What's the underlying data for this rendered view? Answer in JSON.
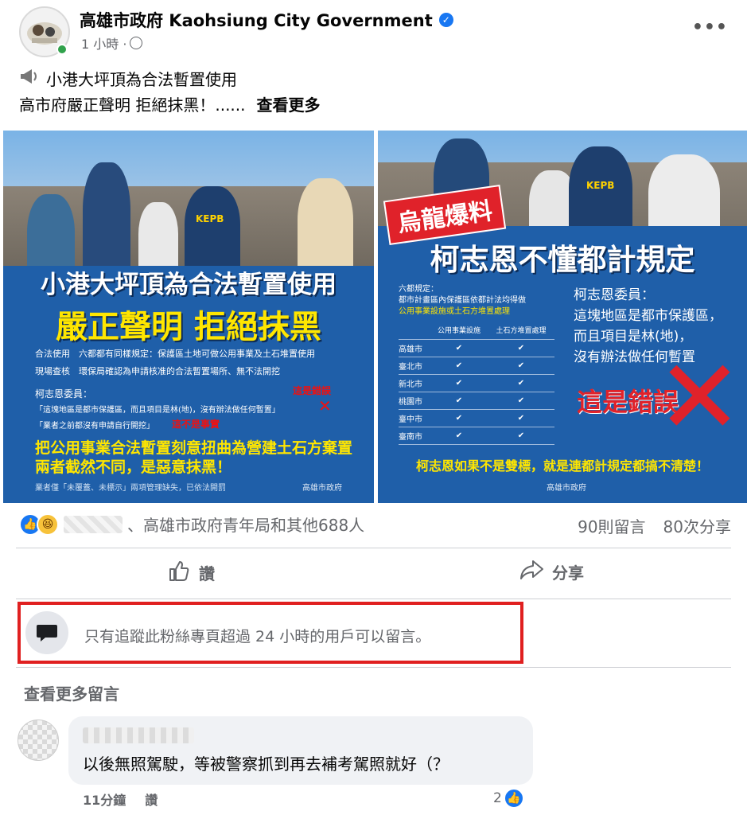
{
  "page": {
    "name": "高雄市政府 Kaohsiung City Government",
    "time": "1 小時 ·",
    "more_label": "•••"
  },
  "post": {
    "line1": "小港大坪頂為合法暫置使用",
    "line2": "高市府嚴正聲明 拒絕抹黑！......",
    "see_more": "查看更多"
  },
  "image_left": {
    "headline1": "小港大坪頂為合法暫置使用",
    "headline2": "嚴正聲明 拒絕抹黑",
    "kepb": "KEPB",
    "point1": "合法使用　六都都有同樣規定：保護區土地可做公用事業及土石堆置使用",
    "point2": "現場查核　環保局確認為申請核准的合法暫置場所、無不法開挖",
    "ko_label": "柯志恩委員：",
    "ko_quote1": "「這塊地區是都市保護區，而且項目是林(地)，沒有辦法做任何暫置」",
    "ko_quote2": "「業者之前都沒有申請自行開挖」",
    "wrong_tag1": "這是錯誤",
    "wrong_tag2": "這不是事實",
    "yellow1": "把公用事業合法暫置刻意扭曲為營建土石方棄置",
    "yellow2": "兩者截然不同，是惡意抹黑！",
    "footer": "業者僅「未覆蓋、未標示」兩項管理缺失，已依法開罰",
    "sign": "高雄市政府"
  },
  "image_right": {
    "banner": "烏龍爆料",
    "title": "柯志恩不懂都計規定",
    "rule_label": "六都規定：",
    "rule_text": "都市計畫區內保護區依都計法均得做",
    "rule_text2": "公用事業設施或土石方堆置處理",
    "col1": "公用事業設施",
    "col2": "土石方堆置處理",
    "cities": [
      "高雄市",
      "臺北市",
      "新北市",
      "桃園市",
      "臺中市",
      "臺南市"
    ],
    "check": "✔",
    "ko_label": "柯志恩委員：",
    "quote1": "這塊地區是都市保護區，",
    "quote2": "而且項目是林(地)，",
    "quote3": "沒有辦法做任何暫置",
    "wrong": "這是錯誤",
    "bottom": "柯志恩如果不是雙標，就是連都計規定都搞不清楚！",
    "sign": "高雄市政府"
  },
  "reactions": {
    "summary": "、高雄市政府青年局和其他688人",
    "comments": "90則留言",
    "shares": "80次分享"
  },
  "actions": {
    "like": "讚",
    "share": "分享"
  },
  "notice": {
    "text": "只有追蹤此粉絲專頁超過 24 小時的用戶可以留言。"
  },
  "comments_section": {
    "more": "查看更多留言",
    "items": [
      {
        "text": "以後無照駕駛，等被警察抓到再去補考駕照就好（？",
        "time": "11分鐘",
        "like_label": "讚",
        "like_count": "2"
      }
    ]
  },
  "colors": {
    "brand_blue": "#1877f2",
    "poster_blue": "#1f5fa9",
    "highlight_red": "#e02020",
    "poster_yellow": "#ffe600"
  }
}
